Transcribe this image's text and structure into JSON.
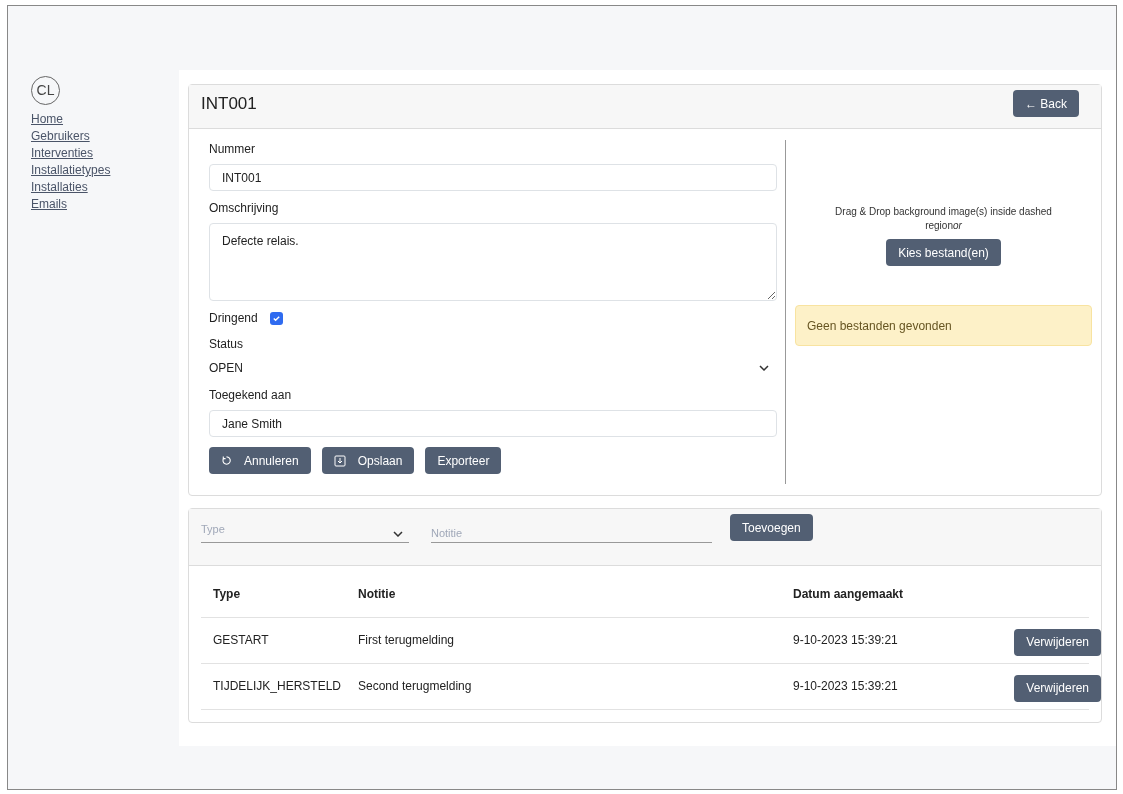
{
  "sidebar": {
    "avatar": "CL",
    "items": [
      {
        "label": "Home"
      },
      {
        "label": "Gebruikers"
      },
      {
        "label": "Interventies"
      },
      {
        "label": "Installatietypes"
      },
      {
        "label": "Installaties"
      },
      {
        "label": "Emails"
      }
    ]
  },
  "card": {
    "title": "INT001",
    "back_button": "← Back",
    "fields": [
      {
        "kind": "input",
        "label": "Nummer",
        "value": "INT001"
      },
      {
        "kind": "textarea",
        "label": "Omschrijving",
        "value": "Defecte relais."
      },
      {
        "kind": "checkbox",
        "label": "Dringend",
        "checked": true
      },
      {
        "kind": "select",
        "label": "Status",
        "value": "OPEN"
      },
      {
        "kind": "input",
        "label": "Toegekend aan",
        "value": "Jane Smith"
      }
    ],
    "buttons": [
      {
        "kind": "reset",
        "label": "Annuleren"
      },
      {
        "kind": "save",
        "label": "Opslaan"
      },
      {
        "kind": "plain",
        "label": "Exporteer"
      }
    ],
    "upload": {
      "hint": "Drag & Drop background image(s) inside dashed region",
      "hint_italic": "or",
      "button": "Kies bestand(en)",
      "alert": "Geen bestanden gevonden"
    }
  },
  "notes": {
    "type_placeholder": "Type",
    "note_placeholder": "Notitie",
    "add_button": "Toevoegen",
    "columns": [
      "Type",
      "Notitie",
      "Datum aangemaakt"
    ],
    "rows": [
      {
        "type": "GESTART",
        "note": "First terugmelding",
        "date": "9-10-2023 15:39:21",
        "action": "Verwijderen"
      },
      {
        "type": "TIJDELIJK_HERSTELD",
        "note": "Second terugmelding",
        "date": "9-10-2023 15:39:21",
        "action": "Verwijderen"
      }
    ]
  }
}
